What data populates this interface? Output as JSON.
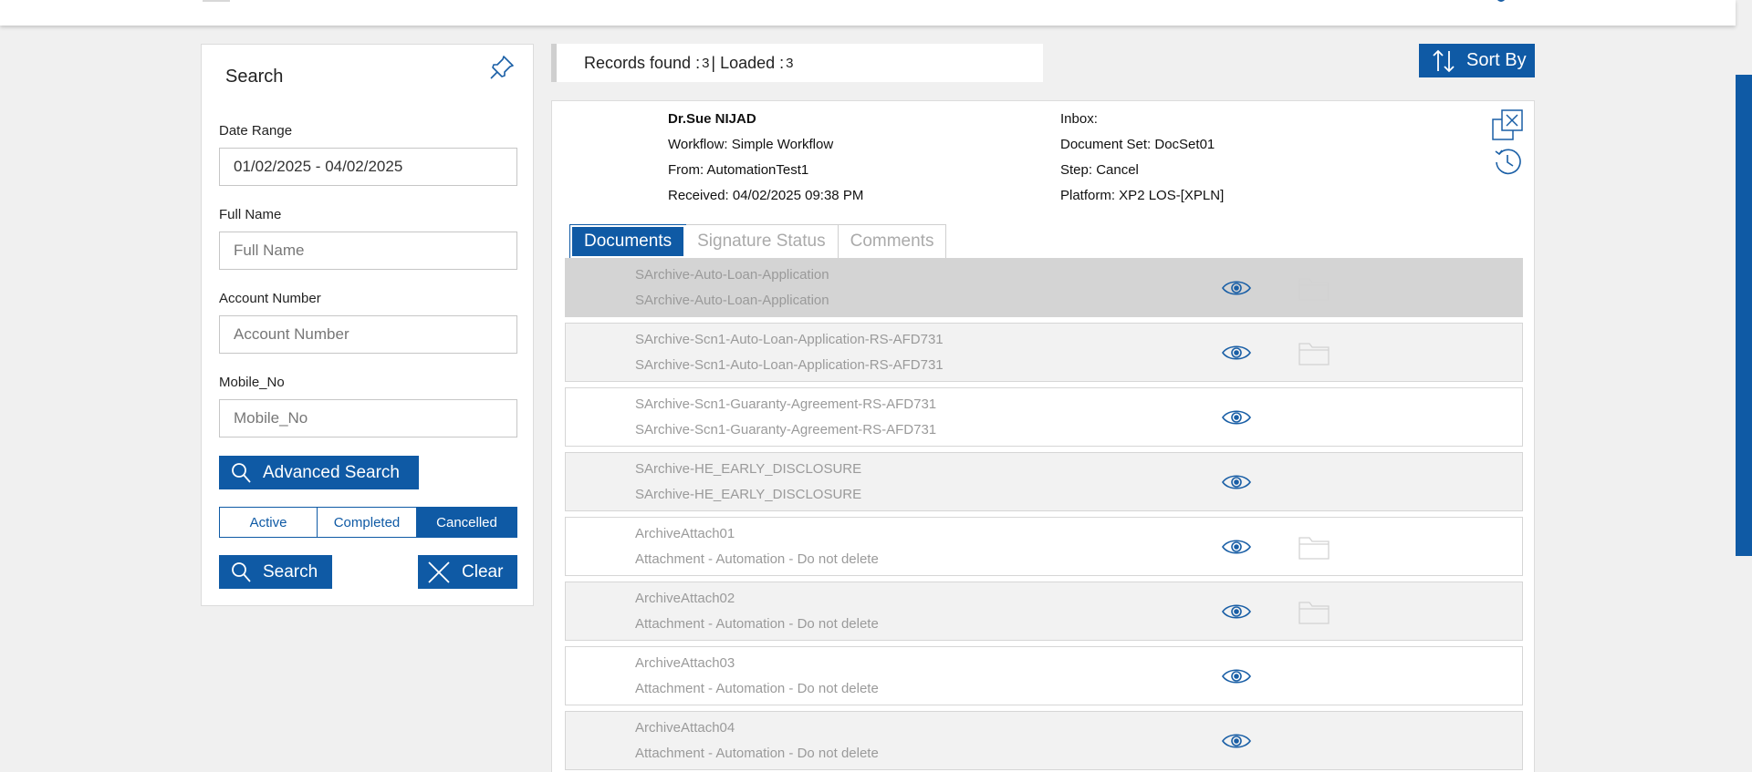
{
  "search_panel": {
    "title": "Search",
    "date_range": {
      "label": "Date Range",
      "value": "01/02/2025 - 04/02/2025"
    },
    "full_name": {
      "label": "Full Name",
      "placeholder": "Full Name"
    },
    "account_number": {
      "label": "Account Number",
      "placeholder": "Account Number"
    },
    "mobile_no": {
      "label": "Mobile_No",
      "placeholder": "Mobile_No"
    },
    "advanced_search_label": "Advanced Search",
    "status_filters": [
      "Active",
      "Completed",
      "Cancelled"
    ],
    "selected_status": "Cancelled",
    "search_label": "Search",
    "clear_label": "Clear"
  },
  "records": {
    "found_label": "Records found : ",
    "found": "3",
    "separator": " | Loaded : ",
    "loaded": "3"
  },
  "sort_by_label": "Sort By",
  "detail": {
    "name": "Dr.Sue NIJAD",
    "workflow": "Workflow: Simple Workflow",
    "from": "From: AutomationTest1",
    "received": "Received: 04/02/2025 09:38 PM",
    "inbox": "Inbox:",
    "document_set": "Document Set: DocSet01",
    "step": "Step: Cancel",
    "platform": "Platform: XP2 LOS-[XPLN]"
  },
  "tabs": [
    {
      "label": "Documents",
      "active": true
    },
    {
      "label": "Signature Status",
      "active": false
    },
    {
      "label": "Comments",
      "active": false
    }
  ],
  "documents": [
    {
      "title": "SArchive-Auto-Loan-Application",
      "subtitle": "SArchive-Auto-Loan-Application",
      "has_folder": true,
      "selected": true
    },
    {
      "title": "SArchive-Scn1-Auto-Loan-Application-RS-AFD731",
      "subtitle": "SArchive-Scn1-Auto-Loan-Application-RS-AFD731",
      "has_folder": true,
      "selected": false
    },
    {
      "title": "SArchive-Scn1-Guaranty-Agreement-RS-AFD731",
      "subtitle": "SArchive-Scn1-Guaranty-Agreement-RS-AFD731",
      "has_folder": false,
      "selected": false
    },
    {
      "title": "SArchive-HE_EARLY_DISCLOSURE",
      "subtitle": "SArchive-HE_EARLY_DISCLOSURE",
      "has_folder": false,
      "selected": false
    },
    {
      "title": "ArchiveAttach01",
      "subtitle": "Attachment - Automation - Do not delete",
      "has_folder": true,
      "selected": false
    },
    {
      "title": "ArchiveAttach02",
      "subtitle": "Attachment - Automation - Do not delete",
      "has_folder": true,
      "selected": false
    },
    {
      "title": "ArchiveAttach03",
      "subtitle": "Attachment - Automation - Do not delete",
      "has_folder": false,
      "selected": false
    },
    {
      "title": "ArchiveAttach04",
      "subtitle": "Attachment - Automation - Do not delete",
      "has_folder": false,
      "selected": false
    }
  ],
  "colors": {
    "accent": "#0f5aa5",
    "background": "#f0f0f0",
    "selected_row": "#d4d4d4",
    "muted_text": "#9a9a9a"
  },
  "icons": [
    "pin-icon",
    "search-icon",
    "clear-x-icon",
    "sort-arrows-icon",
    "close-copy-icon",
    "history-clock-icon",
    "eye-icon",
    "folder-icon"
  ]
}
